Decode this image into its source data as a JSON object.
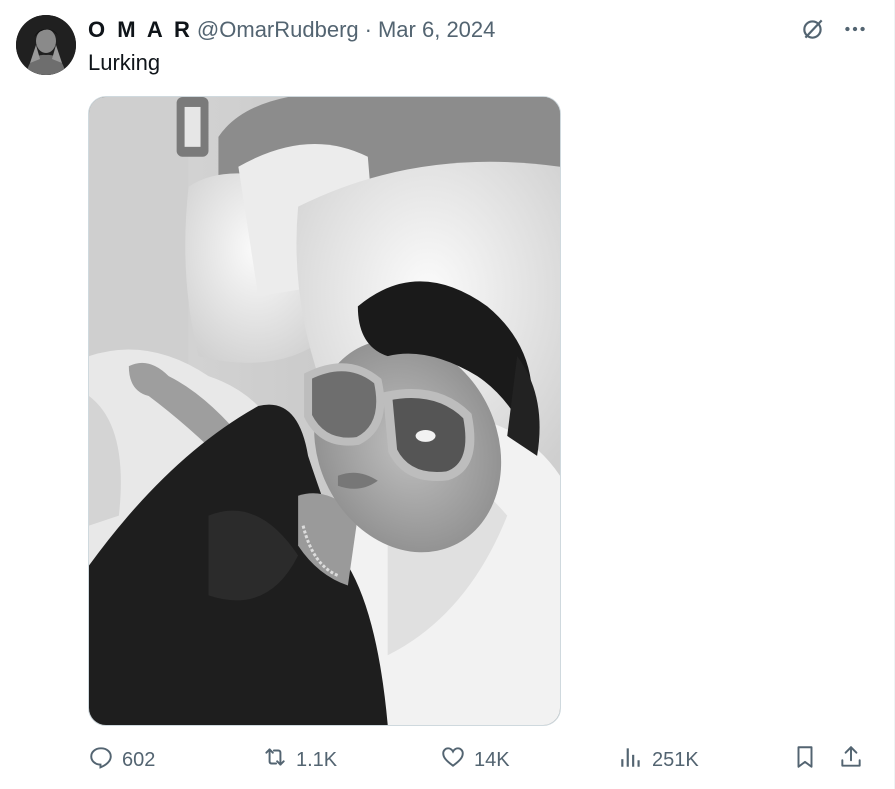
{
  "tweet": {
    "display_name": "O M A R",
    "handle": "@OmarRudberg",
    "separator": "·",
    "date": "Mar 6, 2024",
    "text": "Lurking"
  },
  "actions": {
    "reply_count": "602",
    "retweet_count": "1.1K",
    "like_count": "14K",
    "views_count": "251K"
  },
  "icons": {
    "grok": "grok-icon",
    "more": "more-icon",
    "reply": "reply-icon",
    "retweet": "retweet-icon",
    "like": "heart-icon",
    "views": "views-icon",
    "bookmark": "bookmark-icon",
    "share": "share-icon"
  },
  "colors": {
    "text_primary": "#0f1419",
    "text_secondary": "#536471",
    "border": "#cfd9de"
  }
}
